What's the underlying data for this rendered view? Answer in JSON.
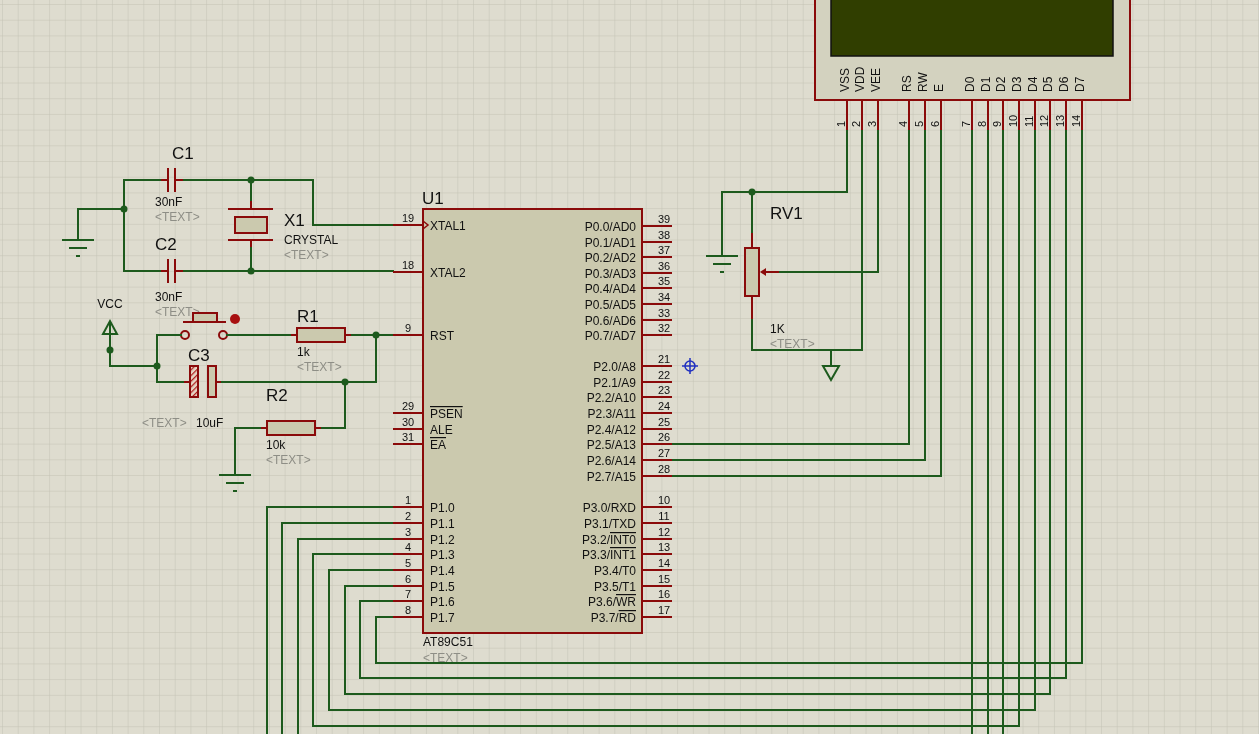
{
  "schematic": {
    "components": [
      {
        "kind": "capacitor",
        "ref": "C1",
        "value": "30nF",
        "text": "<TEXT>"
      },
      {
        "kind": "capacitor",
        "ref": "C2",
        "value": "30nF",
        "text": "<TEXT>"
      },
      {
        "kind": "crystal",
        "ref": "X1",
        "value": "CRYSTAL",
        "text": "<TEXT>"
      },
      {
        "kind": "resistor",
        "ref": "R1",
        "value": "1k",
        "text": "<TEXT>"
      },
      {
        "kind": "electrolytic_capacitor",
        "ref": "C3",
        "value": "10uF",
        "text": "<TEXT>"
      },
      {
        "kind": "resistor",
        "ref": "R2",
        "value": "10k",
        "text": "<TEXT>"
      },
      {
        "kind": "potentiometer",
        "ref": "RV1",
        "value": "1K",
        "text": "<TEXT>"
      }
    ],
    "power_terminals": [
      {
        "label": "VCC"
      }
    ],
    "mcu": {
      "ref": "U1",
      "part": "AT89C51",
      "text": "<TEXT>",
      "left_pins": [
        {
          "number": "19",
          "name": [
            {
              "text": "XTAL1",
              "overbar": false
            }
          ]
        },
        {
          "number": "18",
          "name": [
            {
              "text": "XTAL2",
              "overbar": false
            }
          ]
        },
        {
          "number": "9",
          "name": [
            {
              "text": "RST",
              "overbar": false
            }
          ]
        },
        {
          "number": "29",
          "name": [
            {
              "text": "PSEN",
              "overbar": true
            }
          ]
        },
        {
          "number": "30",
          "name": [
            {
              "text": "ALE",
              "overbar": false
            }
          ]
        },
        {
          "number": "31",
          "name": [
            {
              "text": "EA",
              "overbar": true
            }
          ]
        },
        {
          "number": "1",
          "name": [
            {
              "text": "P1.0",
              "overbar": false
            }
          ]
        },
        {
          "number": "2",
          "name": [
            {
              "text": "P1.1",
              "overbar": false
            }
          ]
        },
        {
          "number": "3",
          "name": [
            {
              "text": "P1.2",
              "overbar": false
            }
          ]
        },
        {
          "number": "4",
          "name": [
            {
              "text": "P1.3",
              "overbar": false
            }
          ]
        },
        {
          "number": "5",
          "name": [
            {
              "text": "P1.4",
              "overbar": false
            }
          ]
        },
        {
          "number": "6",
          "name": [
            {
              "text": "P1.5",
              "overbar": false
            }
          ]
        },
        {
          "number": "7",
          "name": [
            {
              "text": "P1.6",
              "overbar": false
            }
          ]
        },
        {
          "number": "8",
          "name": [
            {
              "text": "P1.7",
              "overbar": false
            }
          ]
        }
      ],
      "right_pins": [
        {
          "number": "39",
          "name": [
            {
              "text": "P0.0/AD0",
              "overbar": false
            }
          ]
        },
        {
          "number": "38",
          "name": [
            {
              "text": "P0.1/AD1",
              "overbar": false
            }
          ]
        },
        {
          "number": "37",
          "name": [
            {
              "text": "P0.2/AD2",
              "overbar": false
            }
          ]
        },
        {
          "number": "36",
          "name": [
            {
              "text": "P0.3/AD3",
              "overbar": false
            }
          ]
        },
        {
          "number": "35",
          "name": [
            {
              "text": "P0.4/AD4",
              "overbar": false
            }
          ]
        },
        {
          "number": "34",
          "name": [
            {
              "text": "P0.5/AD5",
              "overbar": false
            }
          ]
        },
        {
          "number": "33",
          "name": [
            {
              "text": "P0.6/AD6",
              "overbar": false
            }
          ]
        },
        {
          "number": "32",
          "name": [
            {
              "text": "P0.7/AD7",
              "overbar": false
            }
          ]
        },
        {
          "number": "21",
          "name": [
            {
              "text": "P2.0/A8",
              "overbar": false
            }
          ]
        },
        {
          "number": "22",
          "name": [
            {
              "text": "P2.1/A9",
              "overbar": false
            }
          ]
        },
        {
          "number": "23",
          "name": [
            {
              "text": "P2.2/A10",
              "overbar": false
            }
          ]
        },
        {
          "number": "24",
          "name": [
            {
              "text": "P2.3/A11",
              "overbar": false
            }
          ]
        },
        {
          "number": "25",
          "name": [
            {
              "text": "P2.4/A12",
              "overbar": false
            }
          ]
        },
        {
          "number": "26",
          "name": [
            {
              "text": "P2.5/A13",
              "overbar": false
            }
          ]
        },
        {
          "number": "27",
          "name": [
            {
              "text": "P2.6/A14",
              "overbar": false
            }
          ]
        },
        {
          "number": "28",
          "name": [
            {
              "text": "P2.7/A15",
              "overbar": false
            }
          ]
        },
        {
          "number": "10",
          "name": [
            {
              "text": "P3.0/RXD",
              "overbar": false
            }
          ]
        },
        {
          "number": "11",
          "name": [
            {
              "text": "P3.1/TXD",
              "overbar": false
            }
          ]
        },
        {
          "number": "12",
          "name": [
            {
              "text": "P3.2/",
              "overbar": false
            },
            {
              "text": "INT0",
              "overbar": true
            }
          ]
        },
        {
          "number": "13",
          "name": [
            {
              "text": "P3.3/",
              "overbar": false
            },
            {
              "text": "INT1",
              "overbar": true
            }
          ]
        },
        {
          "number": "14",
          "name": [
            {
              "text": "P3.4/T0",
              "overbar": false
            }
          ]
        },
        {
          "number": "15",
          "name": [
            {
              "text": "P3.5/T1",
              "overbar": false
            }
          ]
        },
        {
          "number": "16",
          "name": [
            {
              "text": "P3.6/",
              "overbar": false
            },
            {
              "text": "WR",
              "overbar": true
            }
          ]
        },
        {
          "number": "17",
          "name": [
            {
              "text": "P3.7/",
              "overbar": false
            },
            {
              "text": "RD",
              "overbar": true
            }
          ]
        }
      ]
    },
    "lcd": {
      "pins": [
        {
          "number": "1",
          "name": "VSS"
        },
        {
          "number": "2",
          "name": "VDD"
        },
        {
          "number": "3",
          "name": "VEE"
        },
        {
          "number": "4",
          "name": "RS"
        },
        {
          "number": "5",
          "name": "RW"
        },
        {
          "number": "6",
          "name": "E"
        },
        {
          "number": "7",
          "name": "D0"
        },
        {
          "number": "8",
          "name": "D1"
        },
        {
          "number": "9",
          "name": "D2"
        },
        {
          "number": "10",
          "name": "D3"
        },
        {
          "number": "11",
          "name": "D4"
        },
        {
          "number": "12",
          "name": "D5"
        },
        {
          "number": "13",
          "name": "D6"
        },
        {
          "number": "14",
          "name": "D7"
        }
      ]
    }
  }
}
